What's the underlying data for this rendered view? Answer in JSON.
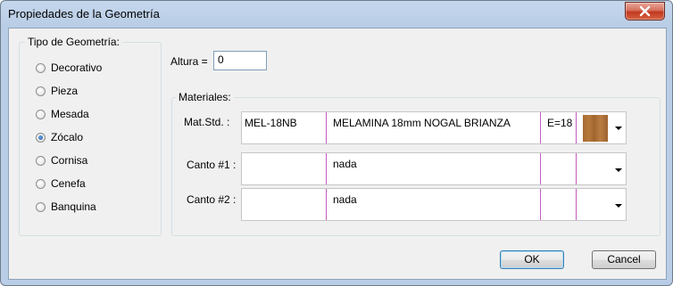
{
  "window": {
    "title": "Propiedades de la Geometría"
  },
  "geometry_type": {
    "legend": "Tipo de Geometría:",
    "options": [
      {
        "label": "Decorativo",
        "checked": false
      },
      {
        "label": "Pieza",
        "checked": false
      },
      {
        "label": "Mesada",
        "checked": false
      },
      {
        "label": "Zócalo",
        "checked": true
      },
      {
        "label": "Cornisa",
        "checked": false
      },
      {
        "label": "Cenefa",
        "checked": false
      },
      {
        "label": "Banquina",
        "checked": false
      }
    ]
  },
  "altura": {
    "label": "Altura =",
    "value": "0"
  },
  "materials": {
    "legend": "Materiales:",
    "rows": [
      {
        "label": "Mat.Std. :",
        "code": "MEL-18NB",
        "description": "MELAMINA 18mm NOGAL BRIANZA",
        "thickness": "E=18",
        "swatch_color": "#a86b32"
      },
      {
        "label": "Canto #1 :",
        "code": "",
        "description": "nada",
        "thickness": ""
      },
      {
        "label": "Canto #2 :",
        "code": "",
        "description": "nada",
        "thickness": ""
      }
    ]
  },
  "buttons": {
    "ok": "OK",
    "cancel": "Cancel"
  }
}
